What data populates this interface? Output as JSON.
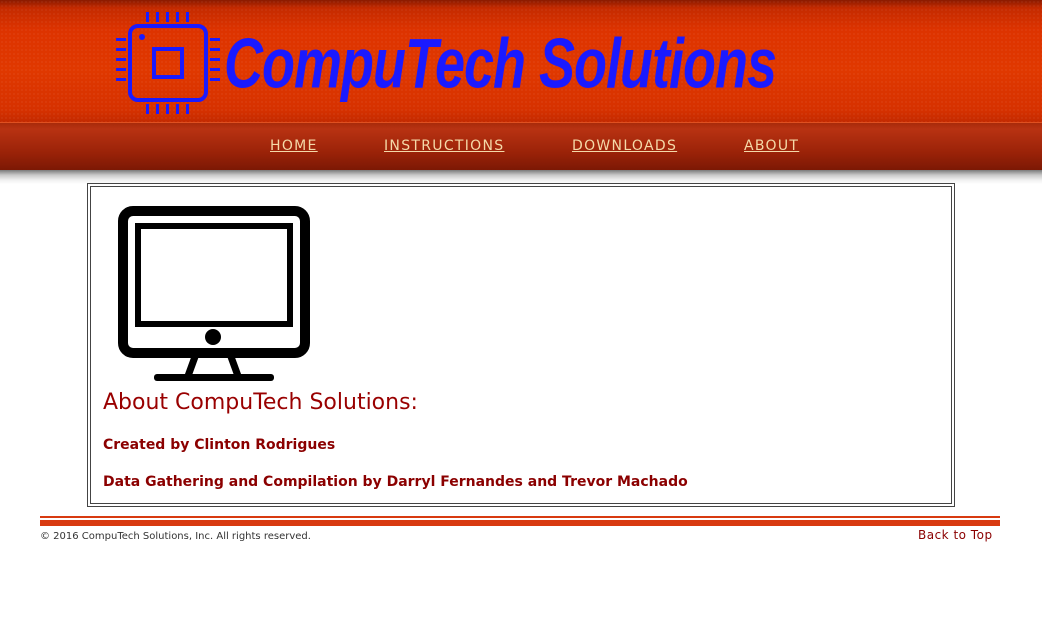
{
  "header": {
    "logo_text": "CompuTech Solutions",
    "logo_icon": "chip-icon",
    "brand_color": "#1a1aff",
    "header_color": "#dd3300"
  },
  "nav": {
    "items": [
      {
        "label": "HOME"
      },
      {
        "label": "INSTRUCTIONS"
      },
      {
        "label": "DOWNLOADS"
      },
      {
        "label": "ABOUT"
      }
    ],
    "link_color": "#f5d9a8"
  },
  "main": {
    "icon": "monitor-icon",
    "title": "About CompuTech Solutions:",
    "lines": [
      "Created by Clinton Rodrigues",
      "Data Gathering and Compilation by Darryl Fernandes and Trevor Machado"
    ],
    "text_color": "#8b0000"
  },
  "footer": {
    "copyright": "© 2016 CompuTech Solutions, Inc. All rights reserved.",
    "back_to_top": "Back to Top",
    "accent_color": "#d83a10"
  }
}
